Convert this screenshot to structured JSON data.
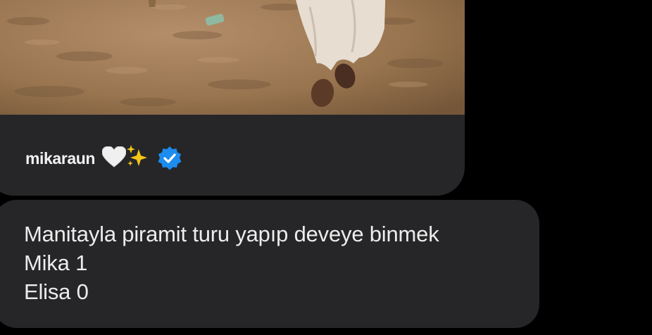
{
  "shared_post": {
    "username": "mikaraun",
    "emojis": [
      "white-heart-icon",
      "sparkles-icon"
    ],
    "verified_badge_color": "#1d8cf0"
  },
  "message": {
    "lines": [
      "Manitayla piramit turu yapıp deveye binmek",
      "Mika 1",
      "Elisa 0"
    ]
  },
  "colors": {
    "background": "#000000",
    "bubble": "#262628",
    "text": "#ececec"
  }
}
